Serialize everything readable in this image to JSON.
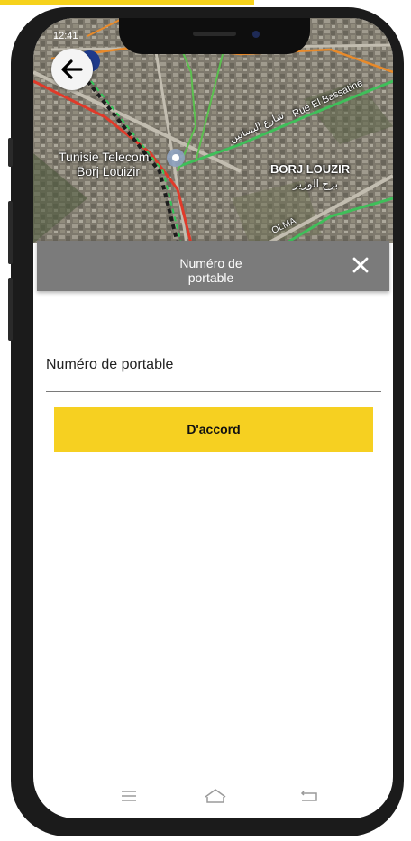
{
  "status": {
    "time": "12:41"
  },
  "map": {
    "labels": {
      "poi_line1": "Tunisie Telecom",
      "poi_line2": "Borj Louizir",
      "district": "BORJ LOUZIR",
      "district_ar": "برج الوزير",
      "road": "Rue El Bassatine",
      "road_ar": "شارع البساتين",
      "road2": "OLMA"
    }
  },
  "header": {
    "title": "Numéro de portable"
  },
  "form": {
    "phone_placeholder": "Numéro de portable"
  },
  "buttons": {
    "confirm": "D'accord"
  },
  "colors": {
    "accent": "#f6d021",
    "header": "#7b7b7b"
  },
  "icons": {
    "back": "arrow-left-icon",
    "close": "close-icon",
    "menu": "menu-icon",
    "home": "home-icon",
    "nav_back": "back-icon"
  }
}
